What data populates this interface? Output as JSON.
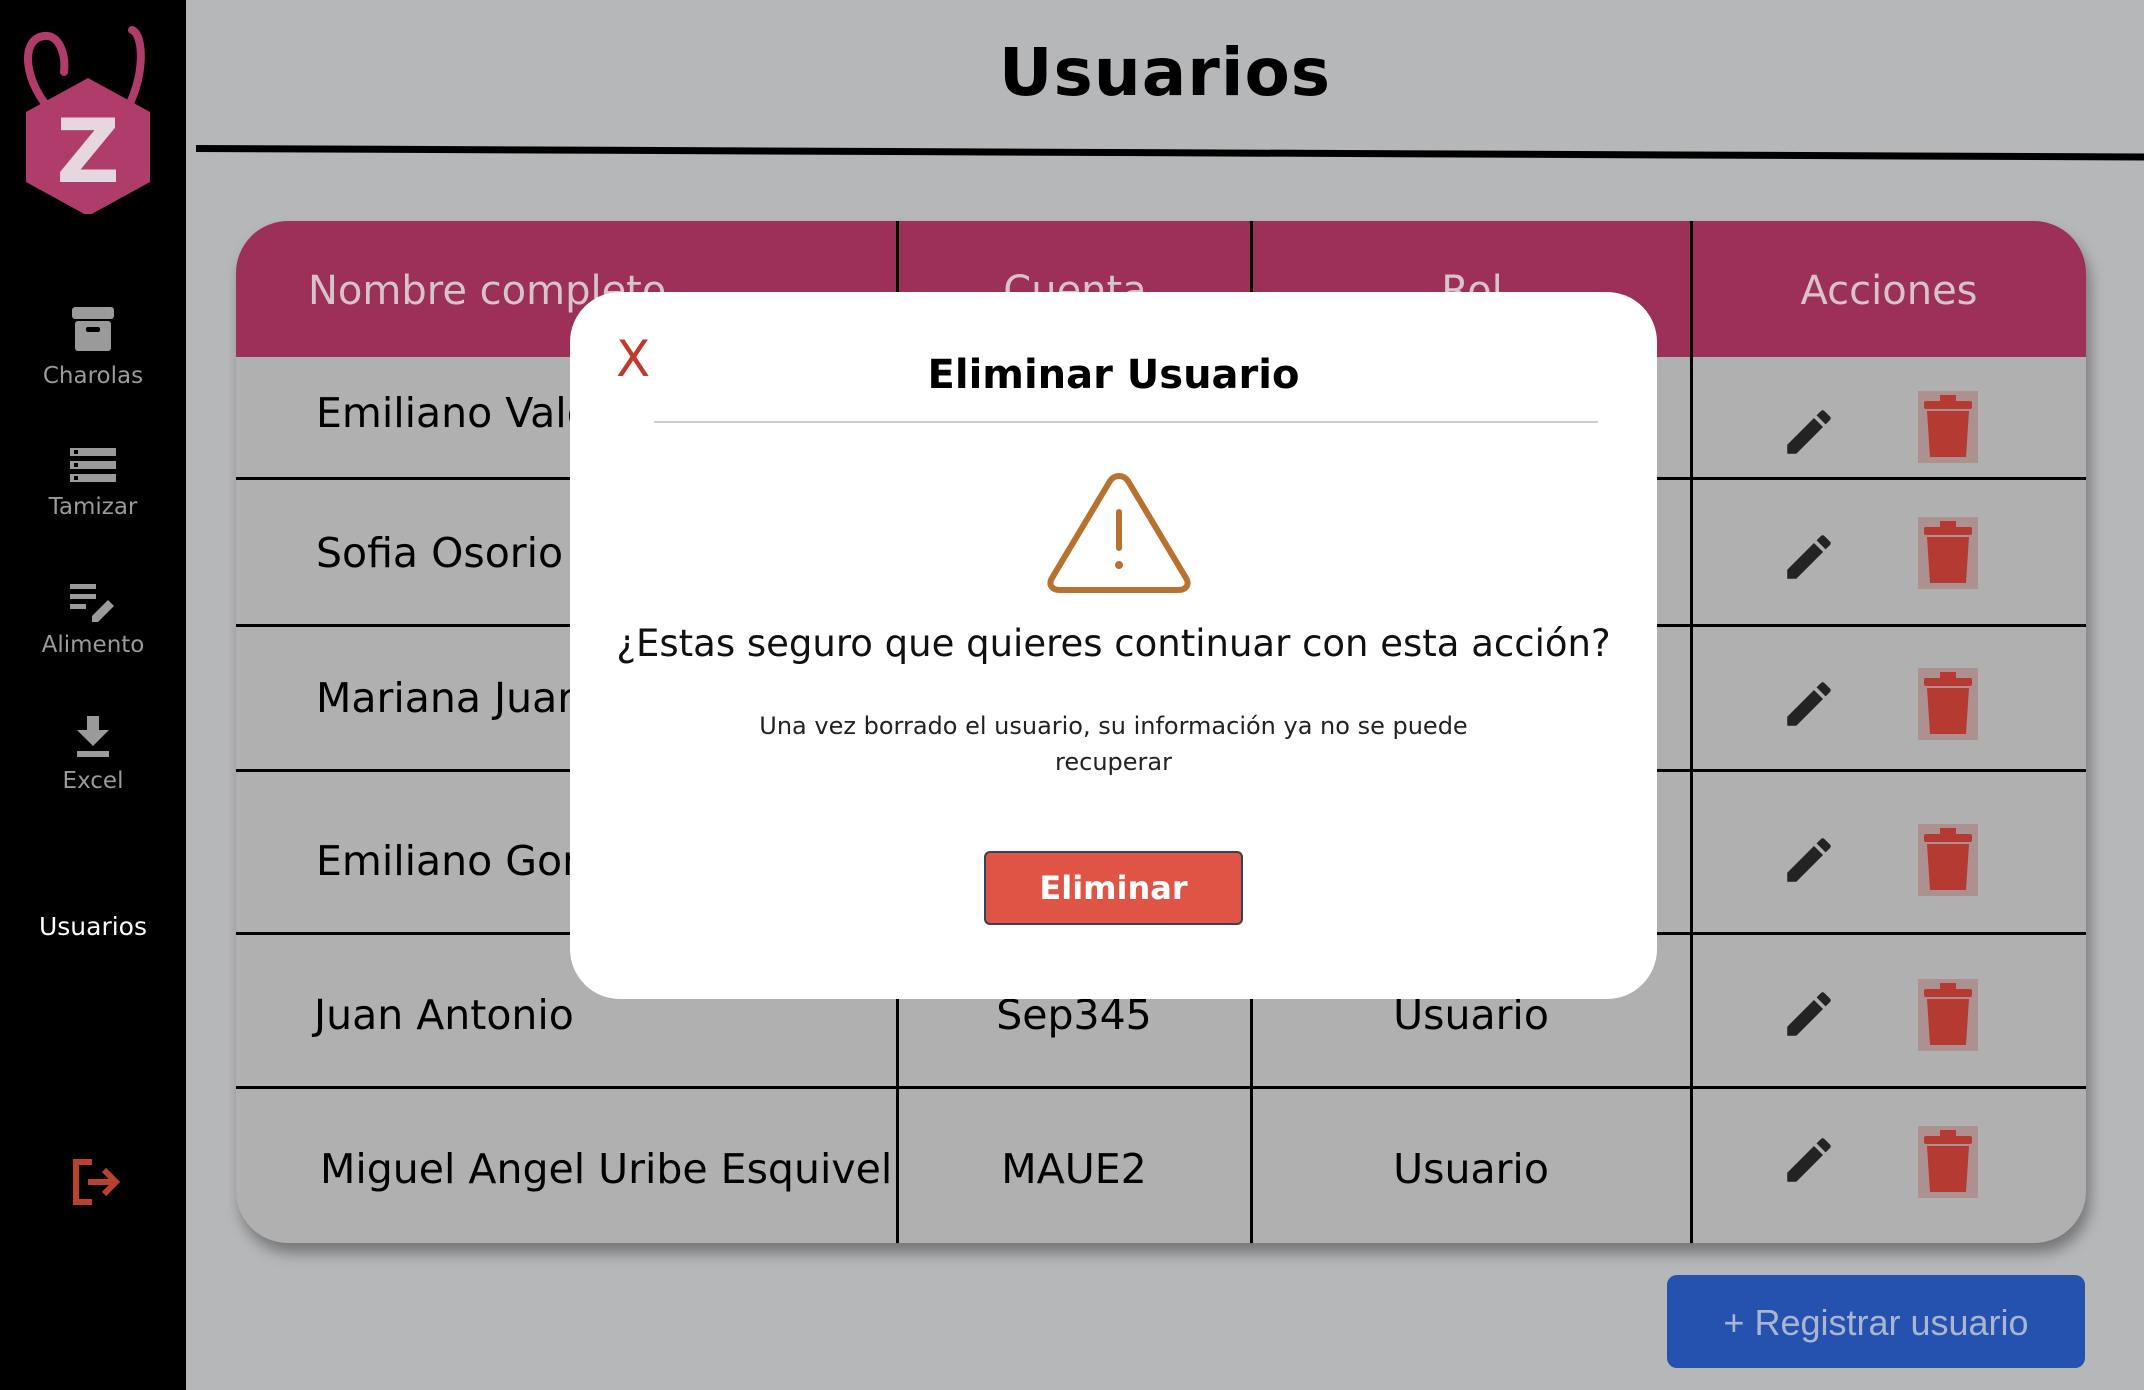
{
  "page": {
    "title": "Usuarios"
  },
  "sidebar": {
    "logo_letter": "Z",
    "items": [
      {
        "label": "Charolas",
        "icon": "archive-icon"
      },
      {
        "label": "Tamizar",
        "icon": "list-icon"
      },
      {
        "label": "Alimento",
        "icon": "edit-list-icon"
      },
      {
        "label": "Excel",
        "icon": "download-icon"
      },
      {
        "label": "Usuarios",
        "icon": ""
      }
    ],
    "logout_icon": "logout-icon"
  },
  "table": {
    "headers": [
      "Nombre completo",
      "Cuenta",
      "Rol",
      "Acciones"
    ],
    "rows": [
      {
        "name": "Emiliano Valc",
        "account": "",
        "role": ""
      },
      {
        "name": "Sofia Osorio S",
        "account": "",
        "role": ""
      },
      {
        "name": "Mariana Juar",
        "account": "",
        "role": ""
      },
      {
        "name": "Emiliano Gon",
        "account": "",
        "role": ""
      },
      {
        "name": "Juan Antonio",
        "account": "Sep345",
        "role": "Usuario"
      },
      {
        "name": "Miguel Angel Uribe Esquivel",
        "account": "MAUE2",
        "role": "Usuario"
      }
    ]
  },
  "register_button": "+ Registrar usuario",
  "modal": {
    "close": "X",
    "title": "Eliminar Usuario",
    "question": "¿Estas seguro que quieres continuar con esta acción?",
    "note": "Una vez borrado el usuario, su información ya no se puede recuperar",
    "confirm": "Eliminar"
  },
  "colors": {
    "header": "#9d3058",
    "delete": "#e05445",
    "register": "#2552ae",
    "warning": "#b8712f"
  }
}
